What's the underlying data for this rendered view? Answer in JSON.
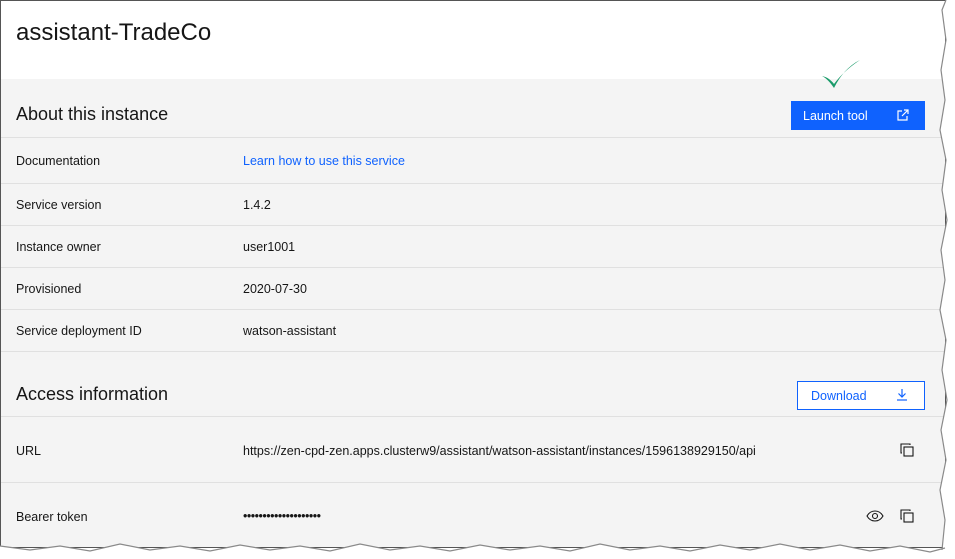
{
  "page": {
    "title": "assistant-TradeCo"
  },
  "about": {
    "heading": "About this instance",
    "launch_label": "Launch tool",
    "launch_icon": "launch-icon",
    "rows": [
      {
        "label": "Documentation",
        "value": "Learn how to use this service"
      },
      {
        "label": "Service version",
        "value": "1.4.2"
      },
      {
        "label": "Instance owner",
        "value": "user1001"
      },
      {
        "label": "Provisioned",
        "value": "2020-07-30"
      },
      {
        "label": "Service deployment ID",
        "value": "watson-assistant"
      }
    ]
  },
  "access": {
    "heading": "Access information",
    "download_label": "Download",
    "download_icon": "download-icon",
    "url_label": "URL",
    "url_value": "https://zen-cpd-zen.apps.clusterw9/assistant/watson-assistant/instances/1596138929150/api",
    "token_label": "Bearer token",
    "token_value": "••••••••••••••••••••"
  },
  "colors": {
    "accent": "#0f62fe",
    "check": "#1a9b6a",
    "panel": "#f4f4f4"
  }
}
